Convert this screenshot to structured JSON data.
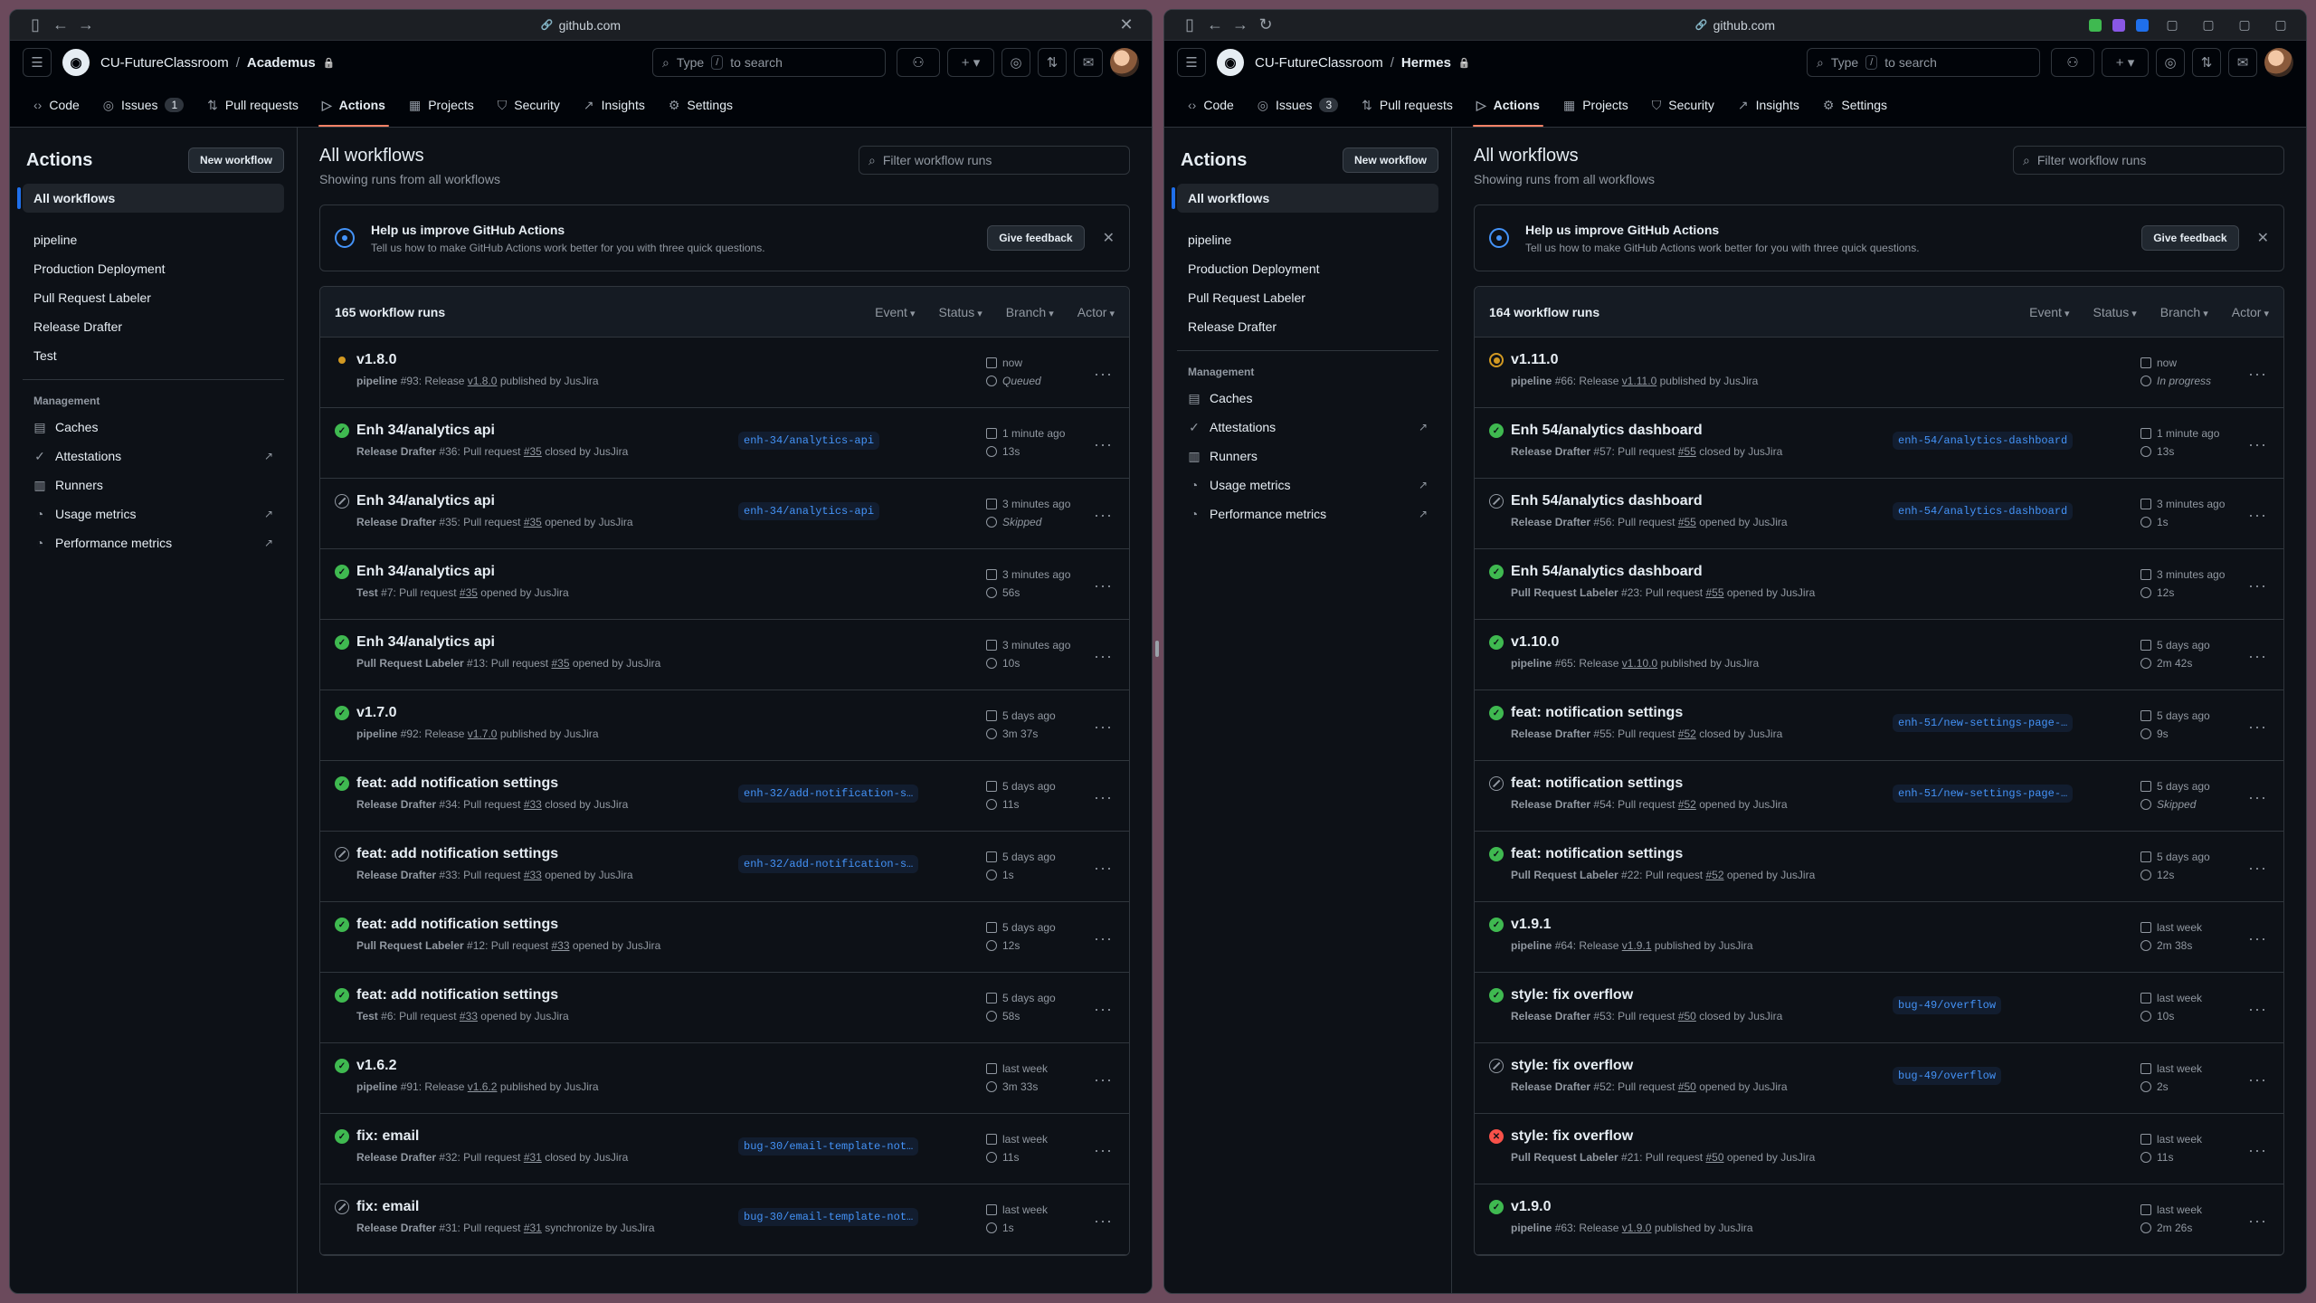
{
  "windows": [
    {
      "id": "left",
      "url": "github.com",
      "org": "CU-FutureClassroom",
      "repo": "Academus",
      "tabs": [
        {
          "label": "Code",
          "icon": "code-icon"
        },
        {
          "label": "Issues",
          "icon": "issue-icon",
          "count": "1"
        },
        {
          "label": "Pull requests",
          "icon": "pull-request-icon"
        },
        {
          "label": "Actions",
          "icon": "play-icon",
          "active": true
        },
        {
          "label": "Projects",
          "icon": "table-icon"
        },
        {
          "label": "Security",
          "icon": "shield-icon"
        },
        {
          "label": "Insights",
          "icon": "graph-icon"
        },
        {
          "label": "Settings",
          "icon": "gear-icon"
        }
      ],
      "search_placeholder_pre": "Type",
      "search_key": "/",
      "search_placeholder_post": "to search",
      "sidebar": {
        "title": "Actions",
        "new_workflow": "New workflow",
        "all_workflows": "All workflows",
        "workflows": [
          "pipeline",
          "Production Deployment",
          "Pull Request Labeler",
          "Release Drafter",
          "Test"
        ],
        "management_label": "Management",
        "management": [
          {
            "label": "Caches",
            "icon": "cache-icon",
            "external": false
          },
          {
            "label": "Attestations",
            "icon": "verified-icon",
            "external": true
          },
          {
            "label": "Runners",
            "icon": "server-icon",
            "external": false
          },
          {
            "label": "Usage metrics",
            "icon": "meter-icon",
            "external": true
          },
          {
            "label": "Performance metrics",
            "icon": "meter-icon",
            "external": true
          }
        ]
      },
      "main": {
        "title": "All workflows",
        "subtitle": "Showing runs from all workflows",
        "filter_placeholder": "Filter workflow runs",
        "banner_title": "Help us improve GitHub Actions",
        "banner_text": "Tell us how to make GitHub Actions work better for you with three quick questions.",
        "feedback": "Give feedback",
        "runs_count": "165 workflow runs",
        "filters": [
          "Event",
          "Status",
          "Branch",
          "Actor"
        ]
      },
      "runs": [
        {
          "status": "queued",
          "title": "v1.8.0",
          "wf": "pipeline",
          "num": "#93",
          "pre": "Release",
          "ref": "v1.8.0",
          "post": "published by JusJira",
          "branch": "",
          "time": "now",
          "dur": "Queued",
          "dur_italic": true
        },
        {
          "status": "success",
          "title": "Enh 34/analytics api",
          "wf": "Release Drafter",
          "num": "#36",
          "pre": "Pull request",
          "ref": "#35",
          "post": "closed by JusJira",
          "branch": "enh-34/analytics-api",
          "time": "1 minute ago",
          "dur": "13s",
          "dur_italic": false
        },
        {
          "status": "skipped",
          "title": "Enh 34/analytics api",
          "wf": "Release Drafter",
          "num": "#35",
          "pre": "Pull request",
          "ref": "#35",
          "post": "opened by JusJira",
          "branch": "enh-34/analytics-api",
          "time": "3 minutes ago",
          "dur": "Skipped",
          "dur_italic": true
        },
        {
          "status": "success",
          "title": "Enh 34/analytics api",
          "wf": "Test",
          "num": "#7",
          "pre": "Pull request",
          "ref": "#35",
          "post": "opened by JusJira",
          "branch": "",
          "time": "3 minutes ago",
          "dur": "56s",
          "dur_italic": false
        },
        {
          "status": "success",
          "title": "Enh 34/analytics api",
          "wf": "Pull Request Labeler",
          "num": "#13",
          "pre": "Pull request",
          "ref": "#35",
          "post": "opened by JusJira",
          "branch": "",
          "time": "3 minutes ago",
          "dur": "10s",
          "dur_italic": false
        },
        {
          "status": "success",
          "title": "v1.7.0",
          "wf": "pipeline",
          "num": "#92",
          "pre": "Release",
          "ref": "v1.7.0",
          "post": "published by JusJira",
          "branch": "",
          "time": "5 days ago",
          "dur": "3m 37s",
          "dur_italic": false
        },
        {
          "status": "success",
          "title": "feat: add notification settings",
          "wf": "Release Drafter",
          "num": "#34",
          "pre": "Pull request",
          "ref": "#33",
          "post": "closed by JusJira",
          "branch": "enh-32/add-notification-s…",
          "time": "5 days ago",
          "dur": "11s",
          "dur_italic": false
        },
        {
          "status": "skipped",
          "title": "feat: add notification settings",
          "wf": "Release Drafter",
          "num": "#33",
          "pre": "Pull request",
          "ref": "#33",
          "post": "opened by JusJira",
          "branch": "enh-32/add-notification-s…",
          "time": "5 days ago",
          "dur": "1s",
          "dur_italic": false
        },
        {
          "status": "success",
          "title": "feat: add notification settings",
          "wf": "Pull Request Labeler",
          "num": "#12",
          "pre": "Pull request",
          "ref": "#33",
          "post": "opened by JusJira",
          "branch": "",
          "time": "5 days ago",
          "dur": "12s",
          "dur_italic": false
        },
        {
          "status": "success",
          "title": "feat: add notification settings",
          "wf": "Test",
          "num": "#6",
          "pre": "Pull request",
          "ref": "#33",
          "post": "opened by JusJira",
          "branch": "",
          "time": "5 days ago",
          "dur": "58s",
          "dur_italic": false
        },
        {
          "status": "success",
          "title": "v1.6.2",
          "wf": "pipeline",
          "num": "#91",
          "pre": "Release",
          "ref": "v1.6.2",
          "post": "published by JusJira",
          "branch": "",
          "time": "last week",
          "dur": "3m 33s",
          "dur_italic": false
        },
        {
          "status": "success",
          "title": "fix: email",
          "wf": "Release Drafter",
          "num": "#32",
          "pre": "Pull request",
          "ref": "#31",
          "post": "closed by JusJira",
          "branch": "bug-30/email-template-not…",
          "time": "last week",
          "dur": "11s",
          "dur_italic": false
        },
        {
          "status": "skipped",
          "title": "fix: email",
          "wf": "Release Drafter",
          "num": "#31",
          "pre": "Pull request",
          "ref": "#31",
          "post": "synchronize by JusJira",
          "branch": "bug-30/email-template-not…",
          "time": "last week",
          "dur": "1s",
          "dur_italic": false
        }
      ]
    },
    {
      "id": "right",
      "url": "github.com",
      "org": "CU-FutureClassroom",
      "repo": "Hermes",
      "tabs": [
        {
          "label": "Code",
          "icon": "code-icon"
        },
        {
          "label": "Issues",
          "icon": "issue-icon",
          "count": "3"
        },
        {
          "label": "Pull requests",
          "icon": "pull-request-icon"
        },
        {
          "label": "Actions",
          "icon": "play-icon",
          "active": true
        },
        {
          "label": "Projects",
          "icon": "table-icon"
        },
        {
          "label": "Security",
          "icon": "shield-icon"
        },
        {
          "label": "Insights",
          "icon": "graph-icon"
        },
        {
          "label": "Settings",
          "icon": "gear-icon"
        }
      ],
      "search_placeholder_pre": "Type",
      "search_key": "/",
      "search_placeholder_post": "to search",
      "sidebar": {
        "title": "Actions",
        "new_workflow": "New workflow",
        "all_workflows": "All workflows",
        "workflows": [
          "pipeline",
          "Production Deployment",
          "Pull Request Labeler",
          "Release Drafter"
        ],
        "management_label": "Management",
        "management": [
          {
            "label": "Caches",
            "icon": "cache-icon",
            "external": false
          },
          {
            "label": "Attestations",
            "icon": "verified-icon",
            "external": true
          },
          {
            "label": "Runners",
            "icon": "server-icon",
            "external": false
          },
          {
            "label": "Usage metrics",
            "icon": "meter-icon",
            "external": true
          },
          {
            "label": "Performance metrics",
            "icon": "meter-icon",
            "external": true
          }
        ]
      },
      "main": {
        "title": "All workflows",
        "subtitle": "Showing runs from all workflows",
        "filter_placeholder": "Filter workflow runs",
        "banner_title": "Help us improve GitHub Actions",
        "banner_text": "Tell us how to make GitHub Actions work better for you with three quick questions.",
        "feedback": "Give feedback",
        "runs_count": "164 workflow runs",
        "filters": [
          "Event",
          "Status",
          "Branch",
          "Actor"
        ]
      },
      "runs": [
        {
          "status": "progress",
          "title": "v1.11.0",
          "wf": "pipeline",
          "num": "#66",
          "pre": "Release",
          "ref": "v1.11.0",
          "post": "published by JusJira",
          "branch": "",
          "time": "now",
          "dur": "In progress",
          "dur_italic": true
        },
        {
          "status": "success",
          "title": "Enh 54/analytics dashboard",
          "wf": "Release Drafter",
          "num": "#57",
          "pre": "Pull request",
          "ref": "#55",
          "post": "closed by JusJira",
          "branch": "enh-54/analytics-dashboard",
          "time": "1 minute ago",
          "dur": "13s",
          "dur_italic": false
        },
        {
          "status": "skipped",
          "title": "Enh 54/analytics dashboard",
          "wf": "Release Drafter",
          "num": "#56",
          "pre": "Pull request",
          "ref": "#55",
          "post": "opened by JusJira",
          "branch": "enh-54/analytics-dashboard",
          "time": "3 minutes ago",
          "dur": "1s",
          "dur_italic": false
        },
        {
          "status": "success",
          "title": "Enh 54/analytics dashboard",
          "wf": "Pull Request Labeler",
          "num": "#23",
          "pre": "Pull request",
          "ref": "#55",
          "post": "opened by JusJira",
          "branch": "",
          "time": "3 minutes ago",
          "dur": "12s",
          "dur_italic": false
        },
        {
          "status": "success",
          "title": "v1.10.0",
          "wf": "pipeline",
          "num": "#65",
          "pre": "Release",
          "ref": "v1.10.0",
          "post": "published by JusJira",
          "branch": "",
          "time": "5 days ago",
          "dur": "2m 42s",
          "dur_italic": false
        },
        {
          "status": "success",
          "title": "feat: notification settings",
          "wf": "Release Drafter",
          "num": "#55",
          "pre": "Pull request",
          "ref": "#52",
          "post": "closed by JusJira",
          "branch": "enh-51/new-settings-page-…",
          "time": "5 days ago",
          "dur": "9s",
          "dur_italic": false
        },
        {
          "status": "skipped",
          "title": "feat: notification settings",
          "wf": "Release Drafter",
          "num": "#54",
          "pre": "Pull request",
          "ref": "#52",
          "post": "opened by JusJira",
          "branch": "enh-51/new-settings-page-…",
          "time": "5 days ago",
          "dur": "Skipped",
          "dur_italic": true
        },
        {
          "status": "success",
          "title": "feat: notification settings",
          "wf": "Pull Request Labeler",
          "num": "#22",
          "pre": "Pull request",
          "ref": "#52",
          "post": "opened by JusJira",
          "branch": "",
          "time": "5 days ago",
          "dur": "12s",
          "dur_italic": false
        },
        {
          "status": "success",
          "title": "v1.9.1",
          "wf": "pipeline",
          "num": "#64",
          "pre": "Release",
          "ref": "v1.9.1",
          "post": "published by JusJira",
          "branch": "",
          "time": "last week",
          "dur": "2m 38s",
          "dur_italic": false
        },
        {
          "status": "success",
          "title": "style: fix overflow",
          "wf": "Release Drafter",
          "num": "#53",
          "pre": "Pull request",
          "ref": "#50",
          "post": "closed by JusJira",
          "branch": "bug-49/overflow",
          "time": "last week",
          "dur": "10s",
          "dur_italic": false
        },
        {
          "status": "skipped",
          "title": "style: fix overflow",
          "wf": "Release Drafter",
          "num": "#52",
          "pre": "Pull request",
          "ref": "#50",
          "post": "opened by JusJira",
          "branch": "bug-49/overflow",
          "time": "last week",
          "dur": "2s",
          "dur_italic": false
        },
        {
          "status": "failure",
          "title": "style: fix overflow",
          "wf": "Pull Request Labeler",
          "num": "#21",
          "pre": "Pull request",
          "ref": "#50",
          "post": "opened by JusJira",
          "branch": "",
          "time": "last week",
          "dur": "11s",
          "dur_italic": false
        },
        {
          "status": "success",
          "title": "v1.9.0",
          "wf": "pipeline",
          "num": "#63",
          "pre": "Release",
          "ref": "v1.9.0",
          "post": "published by JusJira",
          "branch": "",
          "time": "last week",
          "dur": "2m 26s",
          "dur_italic": false
        }
      ]
    }
  ],
  "colors": {
    "accent": "#f78166",
    "success": "#3fb950",
    "failure": "#f85149",
    "pending": "#d29922",
    "link": "#4493f8"
  }
}
